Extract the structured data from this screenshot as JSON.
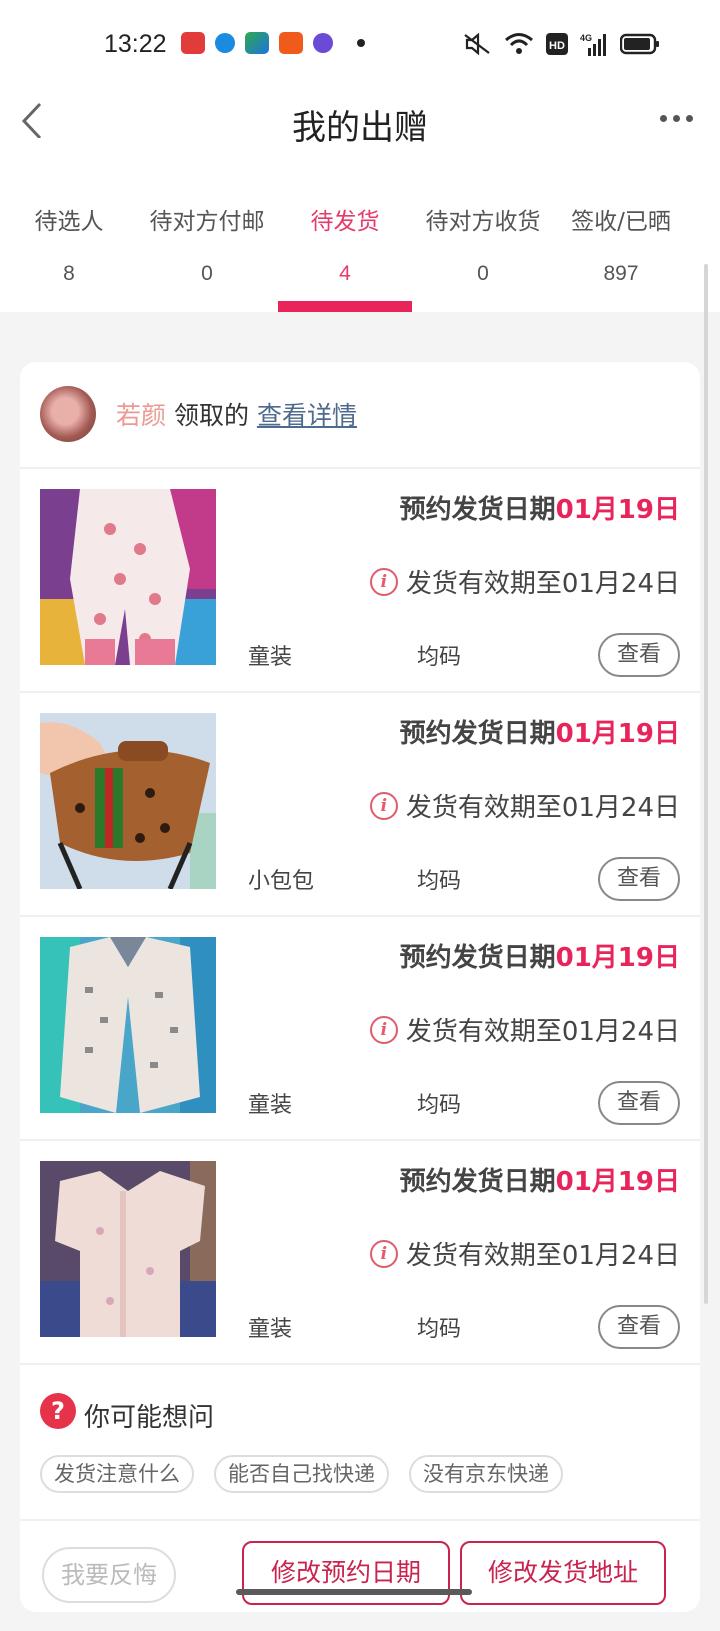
{
  "status": {
    "time": "13:22",
    "icons": [
      "xiaohongshu-app-icon",
      "blue-circle-app-icon",
      "video-app-icon",
      "taobao-app-icon",
      "purple-app-icon",
      "dot-icon",
      "mute-icon",
      "wifi-icon",
      "hd-icon",
      "4g-signal-icon",
      "battery-icon"
    ]
  },
  "nav": {
    "title": "我的出赠"
  },
  "tabs": [
    {
      "label": "待选人",
      "count": "8"
    },
    {
      "label": "待对方付邮",
      "count": "0"
    },
    {
      "label": "待发货",
      "count": "4",
      "active": true
    },
    {
      "label": "待对方收货",
      "count": "0"
    },
    {
      "label": "签收/已晒",
      "count": "897"
    }
  ],
  "receiver": {
    "name": "若颜",
    "suffix": "领取的",
    "link": "查看详情"
  },
  "items": [
    {
      "date_label": "预约发货日期",
      "date": "01月19日",
      "valid": "发货有效期至01月24日",
      "type": "童装",
      "size": "均码",
      "view": "查看",
      "image": "pink-baby-romper-photo"
    },
    {
      "date_label": "预约发货日期",
      "date": "01月19日",
      "valid": "发货有效期至01月24日",
      "type": "小包包",
      "size": "均码",
      "view": "查看",
      "image": "brown-waist-bag-photo"
    },
    {
      "date_label": "预约发货日期",
      "date": "01月19日",
      "valid": "发货有效期至01月24日",
      "type": "童装",
      "size": "均码",
      "view": "查看",
      "image": "white-kids-vest-photo"
    },
    {
      "date_label": "预约发货日期",
      "date": "01月19日",
      "valid": "发货有效期至01月24日",
      "type": "童装",
      "size": "均码",
      "view": "查看",
      "image": "pink-sleep-sack-photo"
    }
  ],
  "faq": {
    "icon": "?",
    "title": "你可能想问",
    "chips": [
      "发货注意什么",
      "能否自己找快递",
      "没有京东快递"
    ]
  },
  "actions": {
    "regret": "我要反悔",
    "change_date": "修改预约日期",
    "change_address": "修改发货地址"
  },
  "colors": {
    "accent": "#e8245a",
    "name": "#ec9a94",
    "link": "#4e6a8e"
  }
}
